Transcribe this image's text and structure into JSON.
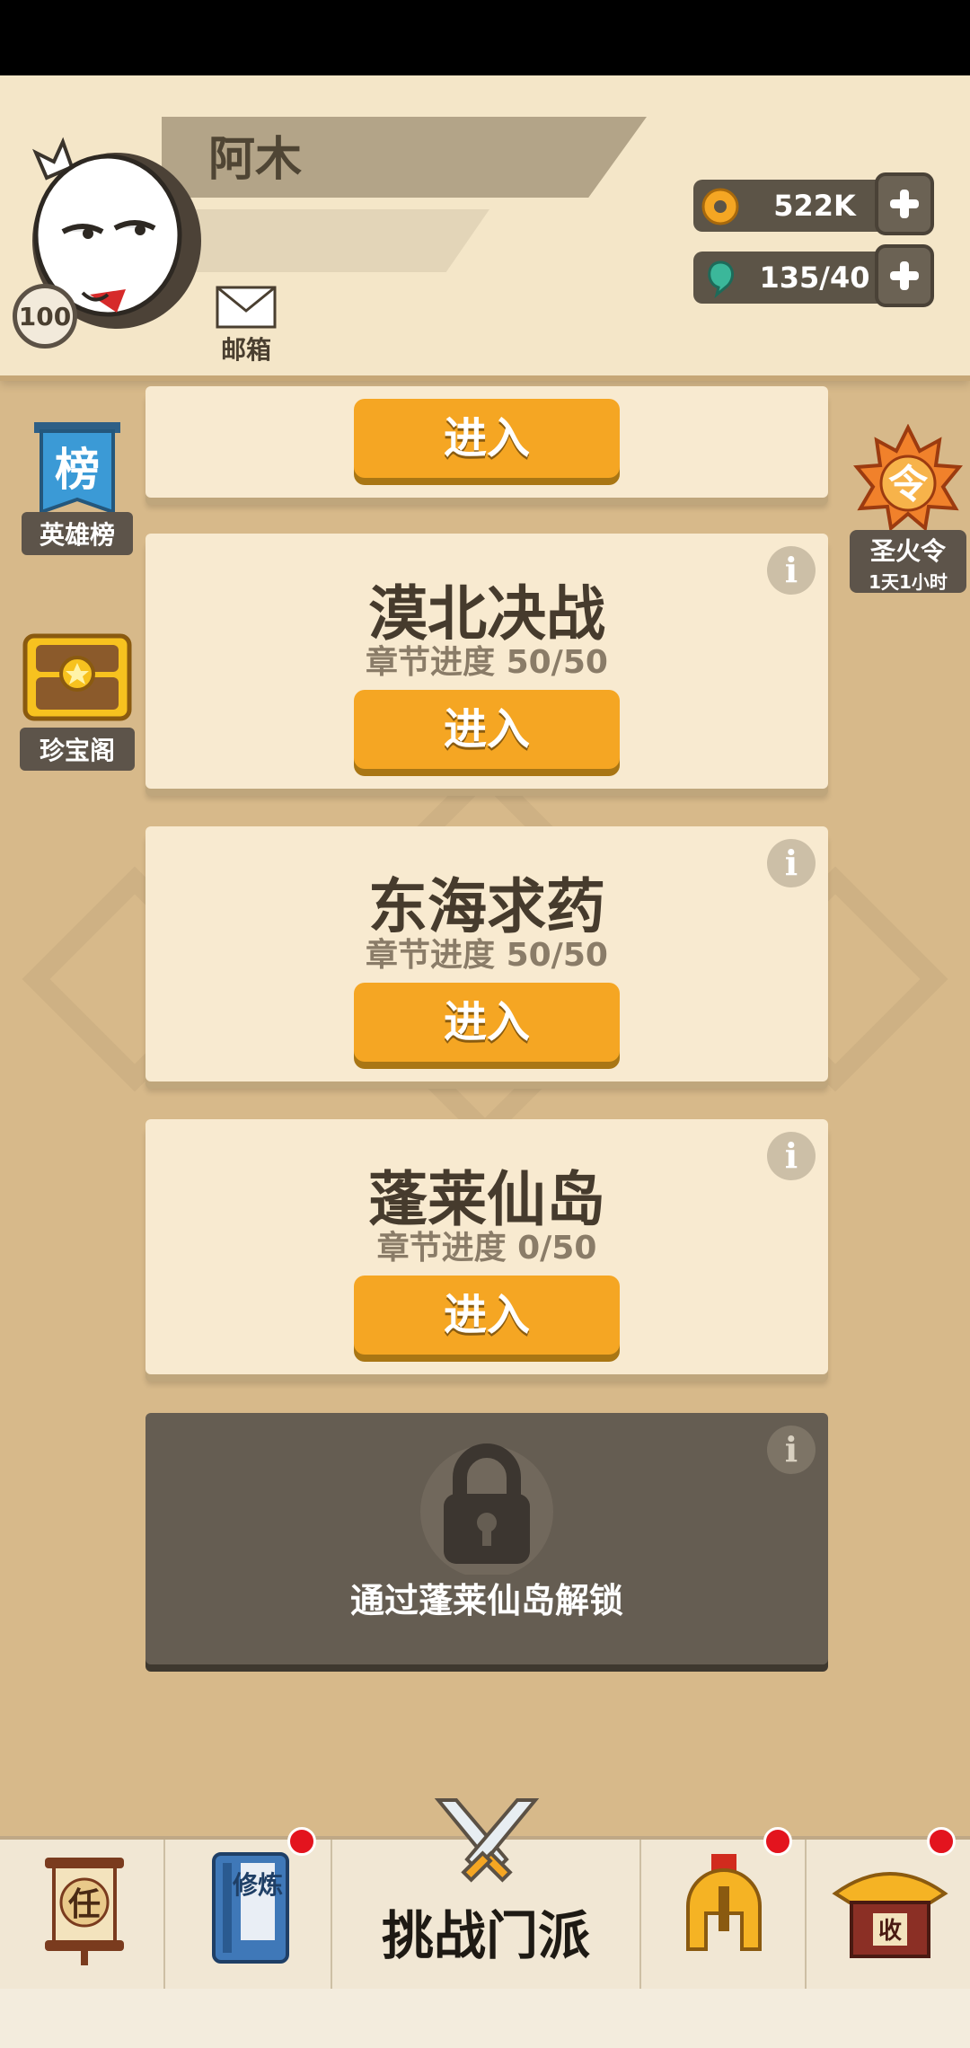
{
  "player": {
    "name": "阿木",
    "level": "100",
    "mail_label": "邮箱"
  },
  "resources": {
    "coins": "522K",
    "gems": "135/40"
  },
  "side_left": {
    "ranking_icon_text": "榜",
    "ranking_label": "英雄榜",
    "treasure_label": "珍宝阁"
  },
  "side_right": {
    "token_icon_text": "令",
    "token_label": "圣火令",
    "token_timer": "1天1小时"
  },
  "cards": [
    {
      "enter": "进入"
    },
    {
      "title": "漠北决战",
      "progress": "章节进度 50/50",
      "enter": "进入"
    },
    {
      "title": "东海求药",
      "progress": "章节进度 50/50",
      "enter": "进入"
    },
    {
      "title": "蓬莱仙岛",
      "progress": "章节进度 0/50",
      "enter": "进入"
    }
  ],
  "locked_card": {
    "text": "通过蓬莱仙岛解锁"
  },
  "bottom_nav": {
    "task_icon_text": "任",
    "train_icon_text": "修炼",
    "challenge_label": "挑战门派",
    "shop_icon_text": "收"
  },
  "colors": {
    "accent": "#f5a623",
    "card_bg": "#f8ead0",
    "locked_bg": "#655d52",
    "badge_red": "#e3141e"
  }
}
